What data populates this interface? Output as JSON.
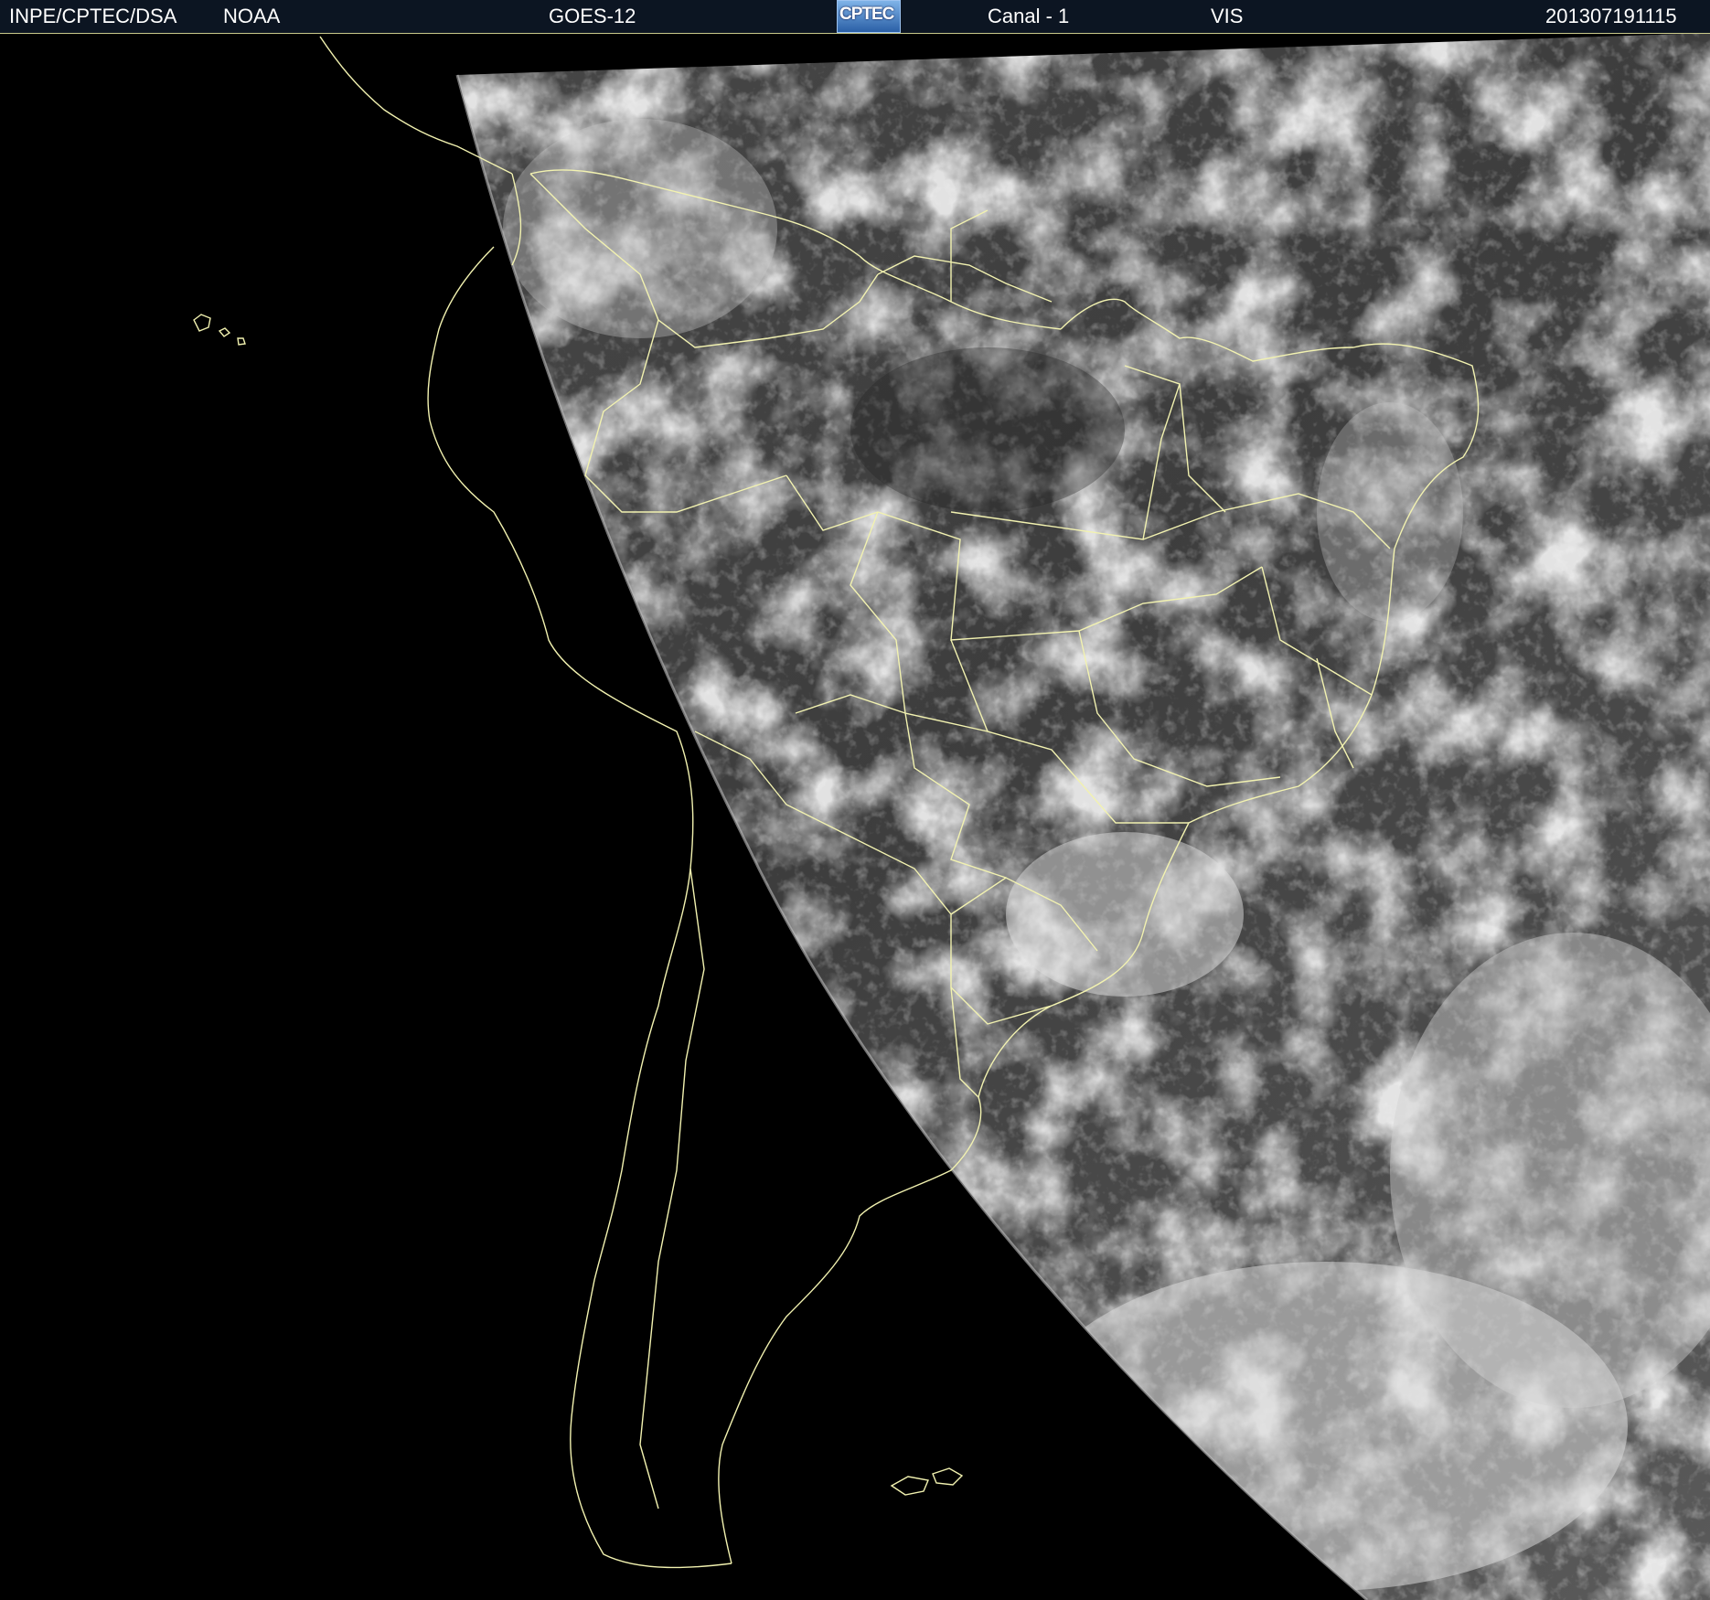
{
  "header": {
    "org": "INPE/CPTEC/DSA",
    "agency": "NOAA",
    "satellite": "GOES-12",
    "logo_text": "CPTEC",
    "channel": "Canal - 1",
    "band": "VIS",
    "timestamp": "201307191115"
  },
  "colors": {
    "header_bg": "#0c1522",
    "borders": "#f2f2b0",
    "space": "#000000",
    "clouds": "#e6e6e6"
  },
  "image": {
    "type": "satellite visible imagery",
    "region": "South America",
    "terminator": "left side in darkness"
  }
}
